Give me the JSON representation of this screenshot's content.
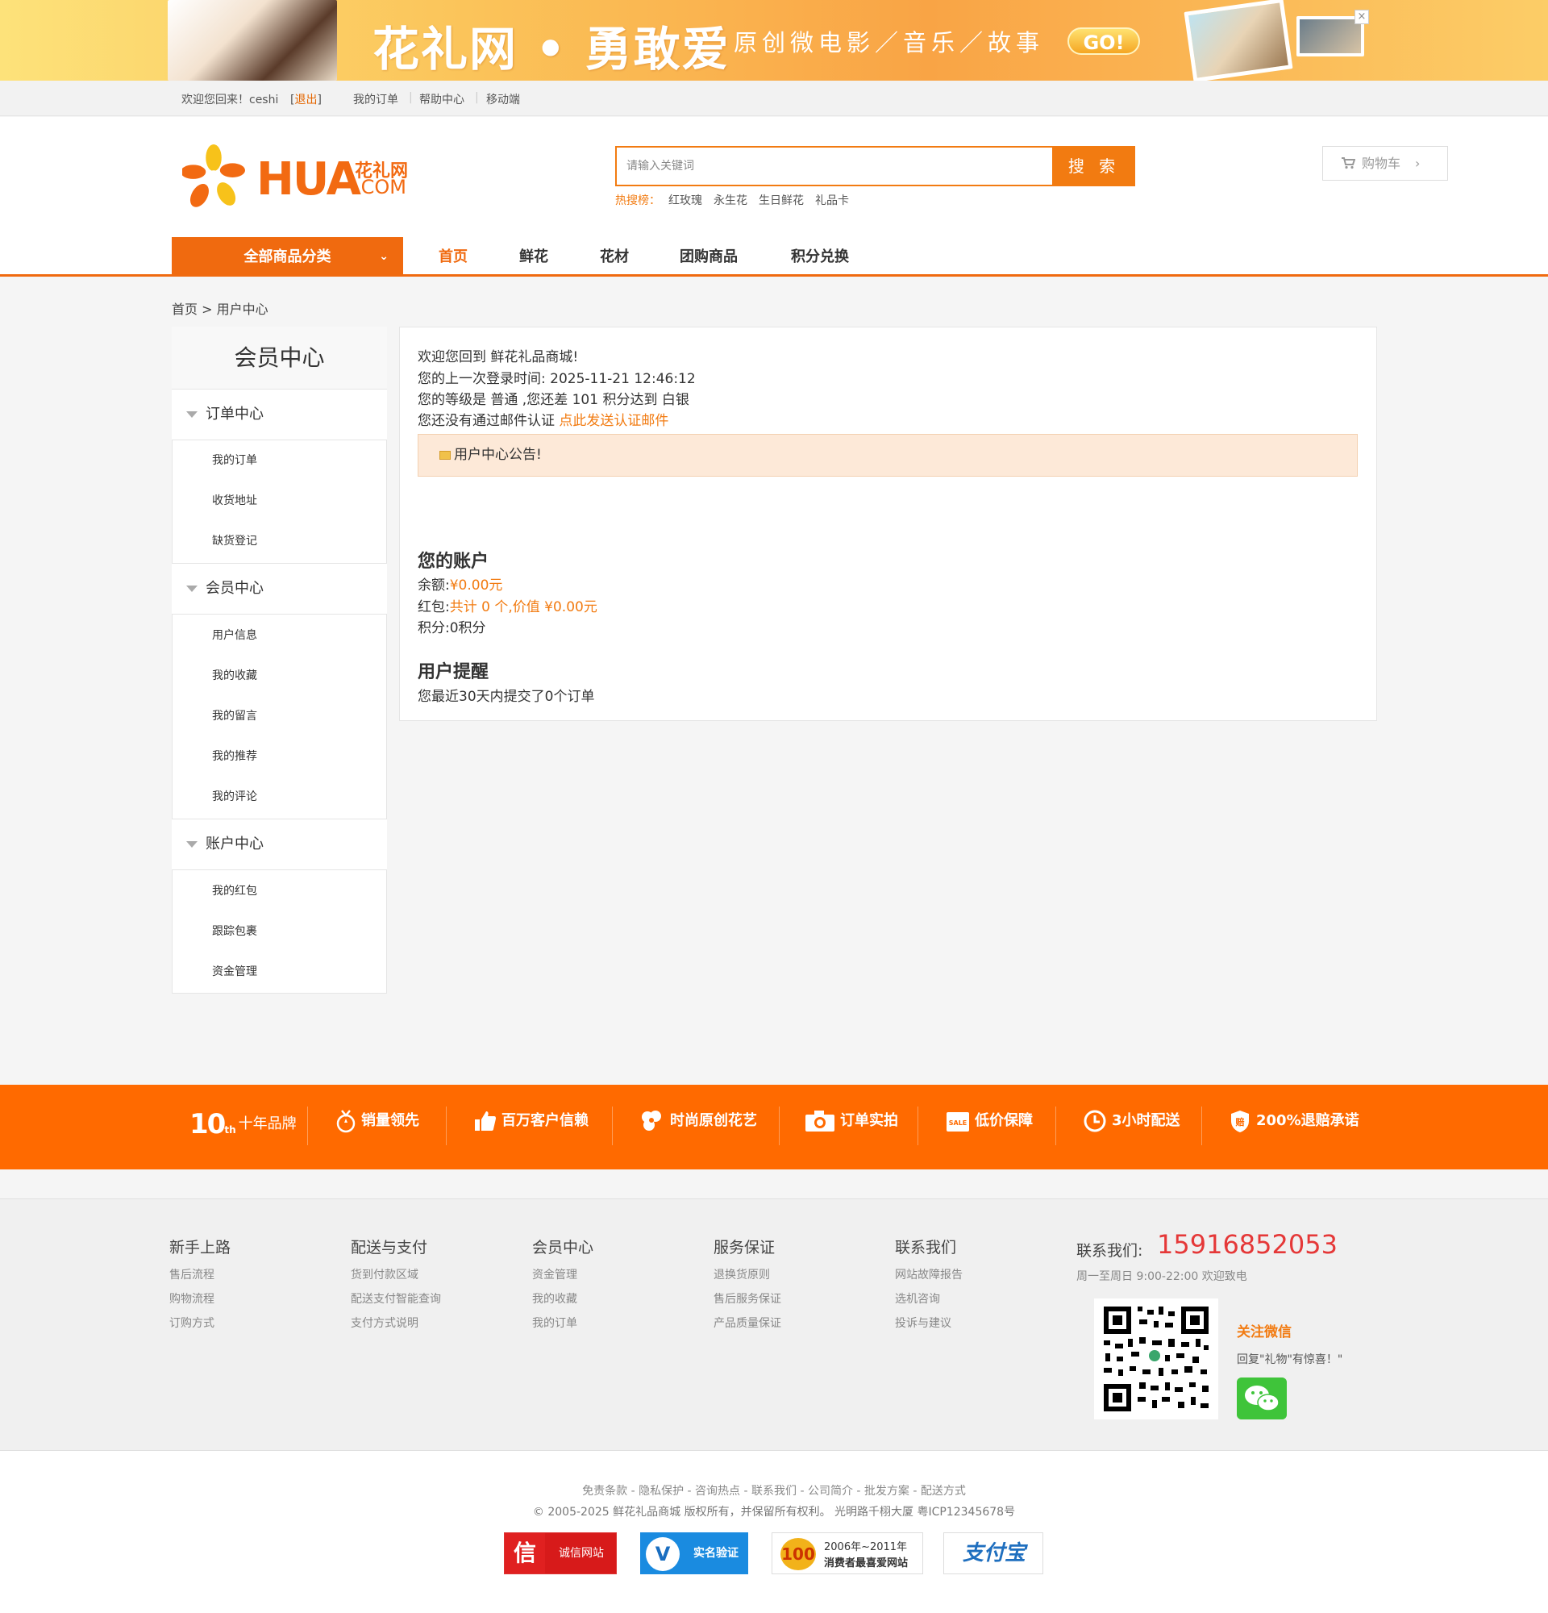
{
  "banner": {
    "title": "花礼网 • 勇敢爱",
    "subtitle": "原创微电影／音乐／故事",
    "go_label": "GO!",
    "close_label": "×"
  },
  "topbar": {
    "welcome": "欢迎您回来！ceshi",
    "logout": "退出",
    "links": [
      "我的订单",
      "帮助中心",
      "移动端"
    ]
  },
  "header": {
    "logo_main": "HUA",
    "logo_cn": "花礼网",
    "logo_com": ".COM",
    "search_placeholder": "请输入关键词",
    "search_button": "搜 索",
    "hot_label": "热搜榜：",
    "hot_keywords": [
      "红玫瑰",
      "永生花",
      "生日鲜花",
      "礼品卡"
    ],
    "cart_label": "购物车"
  },
  "nav": {
    "category_label": "全部商品分类",
    "items": [
      "首页",
      "鲜花",
      "花材",
      "团购商品",
      "积分兑换"
    ]
  },
  "breadcrumb": {
    "home": "首页",
    "sep": ">",
    "current": "用户中心"
  },
  "sidebar": {
    "title": "会员中心",
    "groups": [
      {
        "label": "订单中心",
        "items": [
          "我的订单",
          "收货地址",
          "缺货登记"
        ]
      },
      {
        "label": "会员中心",
        "items": [
          "用户信息",
          "我的收藏",
          "我的留言",
          "我的推荐",
          "我的评论"
        ]
      },
      {
        "label": "账户中心",
        "items": [
          "我的红包",
          "跟踪包裹",
          "资金管理"
        ]
      }
    ]
  },
  "main": {
    "welcome_line": "欢迎您回到 鲜花礼品商城!",
    "last_login": "您的上一次登录时间: 2025-11-21 12:46:12",
    "level_line": "您的等级是 普通 ,您还差 101 积分达到 白银",
    "email_prefix": "您还没有通过邮件认证",
    "email_link": "点此发送认证邮件",
    "notice": "用户中心公告!",
    "account_title": "您的账户",
    "balance_label": "余额:",
    "balance_value": "¥0.00元",
    "redpack_label": "红包:",
    "redpack_value": "共计 0 个,价值 ¥0.00元",
    "points_line": "积分:0积分",
    "remind_title": "用户提醒",
    "remind_line": "您最近30天内提交了0个订单"
  },
  "promise": {
    "ten_num": "10",
    "items": [
      "十年品牌",
      "销量领先",
      "百万客户信赖",
      "时尚原创花艺",
      "订单实拍",
      "低价保障",
      "3小时配送",
      "200%退赔承诺"
    ]
  },
  "footer": {
    "columns": [
      {
        "title": "新手上路",
        "items": [
          "售后流程",
          "购物流程",
          "订购方式"
        ]
      },
      {
        "title": "配送与支付",
        "items": [
          "货到付款区域",
          "配送支付智能查询",
          "支付方式说明"
        ]
      },
      {
        "title": "会员中心",
        "items": [
          "资金管理",
          "我的收藏",
          "我的订单"
        ]
      },
      {
        "title": "服务保证",
        "items": [
          "退换货原则",
          "售后服务保证",
          "产品质量保证"
        ]
      },
      {
        "title": "联系我们",
        "items": [
          "网站故障报告",
          "选机咨询",
          "投诉与建议"
        ]
      }
    ],
    "contact_label": "联系我们:",
    "contact_phone": "15916852053",
    "contact_hours": "周一至周日 9:00-22:00 欢迎致电",
    "wechat_title": "关注微信",
    "wechat_sub": "回复\"礼物\"有惊喜！\"",
    "bottom_links": "免责条款 - 隐私保护 - 咨询热点 - 联系我们 - 公司简介 - 批发方案 - 配送方式",
    "copyright": "© 2005-2025 鲜花礼品商城 版权所有，并保留所有权利。 光明路千栩大厦 粤ICP12345678号",
    "badges": {
      "b1": "诚信网站",
      "b2": "实名验证",
      "b3_l1": "2006年~2011年",
      "b3_l2": "消费者最喜爱网站",
      "b4": "支付宝"
    }
  },
  "colors": {
    "brand": "#f06a0f",
    "promise_bar": "#ff6a00",
    "phone": "#e53838"
  }
}
